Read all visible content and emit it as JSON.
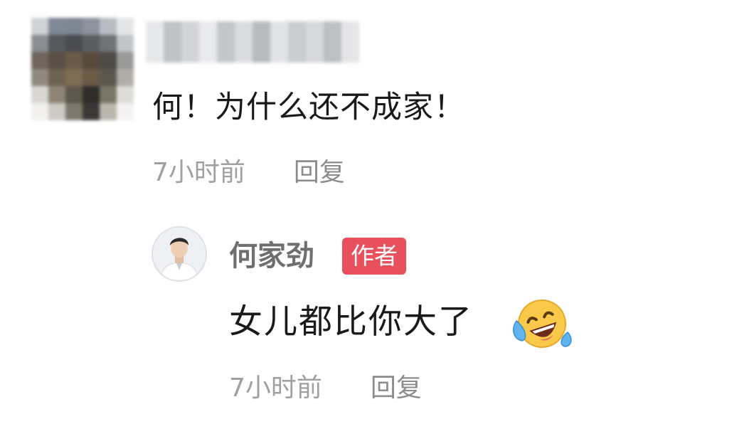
{
  "comment": {
    "text": "何！为什么还不成家！",
    "time": "7小时前",
    "reply_label": "回复"
  },
  "reply": {
    "author": "何家劲",
    "badge": "作者",
    "text": "女儿都比你大了",
    "emoji": "rolling-laughing-emoji",
    "time": "7小时前",
    "reply_label": "回复"
  },
  "colors": {
    "badge_bg": "#e8505b",
    "meta_text": "#a0a0a0",
    "body_text": "#1a1a1a"
  }
}
